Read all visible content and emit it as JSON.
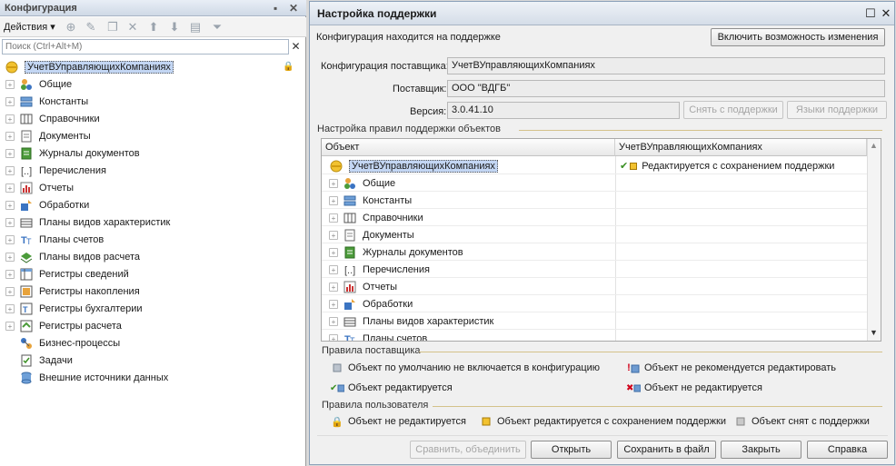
{
  "left_panel": {
    "title": "Конфигурация",
    "actions_label": "Действия ▾",
    "search_placeholder": "Поиск (Ctrl+Alt+M)",
    "root": "УчетВУправляющихКомпаниях",
    "items": [
      {
        "label": "Общие",
        "icon": "common-icon"
      },
      {
        "label": "Константы",
        "icon": "constants-icon"
      },
      {
        "label": "Справочники",
        "icon": "catalogs-icon"
      },
      {
        "label": "Документы",
        "icon": "documents-icon"
      },
      {
        "label": "Журналы документов",
        "icon": "journals-icon"
      },
      {
        "label": "Перечисления",
        "icon": "enums-icon"
      },
      {
        "label": "Отчеты",
        "icon": "reports-icon"
      },
      {
        "label": "Обработки",
        "icon": "processings-icon"
      },
      {
        "label": "Планы видов характеристик",
        "icon": "chart-of-characteristics-icon"
      },
      {
        "label": "Планы счетов",
        "icon": "chart-of-accounts-icon"
      },
      {
        "label": "Планы видов расчета",
        "icon": "calc-types-icon"
      },
      {
        "label": "Регистры сведений",
        "icon": "info-registers-icon"
      },
      {
        "label": "Регистры накопления",
        "icon": "accum-registers-icon"
      },
      {
        "label": "Регистры бухгалтерии",
        "icon": "accounting-registers-icon"
      },
      {
        "label": "Регистры расчета",
        "icon": "calc-registers-icon"
      },
      {
        "label": "Бизнес-процессы",
        "icon": "business-processes-icon"
      },
      {
        "label": "Задачи",
        "icon": "tasks-icon"
      },
      {
        "label": "Внешние источники данных",
        "icon": "external-sources-icon"
      }
    ]
  },
  "dialog": {
    "title": "Настройка поддержки",
    "status_text": "Конфигурация находится на поддержке",
    "enable_changes_button": "Включить возможность изменения",
    "vendor_config_label": "Конфигурация поставщика:",
    "vendor_config_value": "УчетВУправляющихКомпаниях",
    "vendor_label": "Поставщик:",
    "vendor_value": "ООО \"ВДГБ\"",
    "version_label": "Версия:",
    "version_value": "3.0.41.10",
    "remove_support_button": "Снять с поддержки",
    "support_languages_button": "Языки поддержки",
    "rules_group": "Настройка правил поддержки объектов",
    "grid": {
      "col_object": "Объект",
      "col_config": "УчетВУправляющихКомпаниях",
      "root": "УчетВУправляющихКомпаниях",
      "root_rule": "Редактируется с сохранением поддержки",
      "rows": [
        "Общие",
        "Константы",
        "Справочники",
        "Документы",
        "Журналы документов",
        "Перечисления",
        "Отчеты",
        "Обработки",
        "Планы видов характеристик",
        "Планы счетов"
      ]
    },
    "vendor_rules_group": "Правила поставщика",
    "vendor_rules": {
      "default_not_included": "Объект по умолчанию не включается в конфигурацию",
      "not_recommended": "Объект не рекомендуется редактировать",
      "editable": "Объект редактируется",
      "not_editable": "Объект не редактируется"
    },
    "user_rules_group": "Правила пользователя",
    "user_rules": {
      "not_editable": "Объект не редактируется",
      "editable_with_support": "Объект редактируется с сохранением поддержки",
      "removed": "Объект снят с поддержки"
    },
    "buttons": {
      "compare": "Сравнить, объединить",
      "open": "Открыть",
      "save_to_file": "Сохранить в файл",
      "close": "Закрыть",
      "help": "Справка"
    }
  }
}
